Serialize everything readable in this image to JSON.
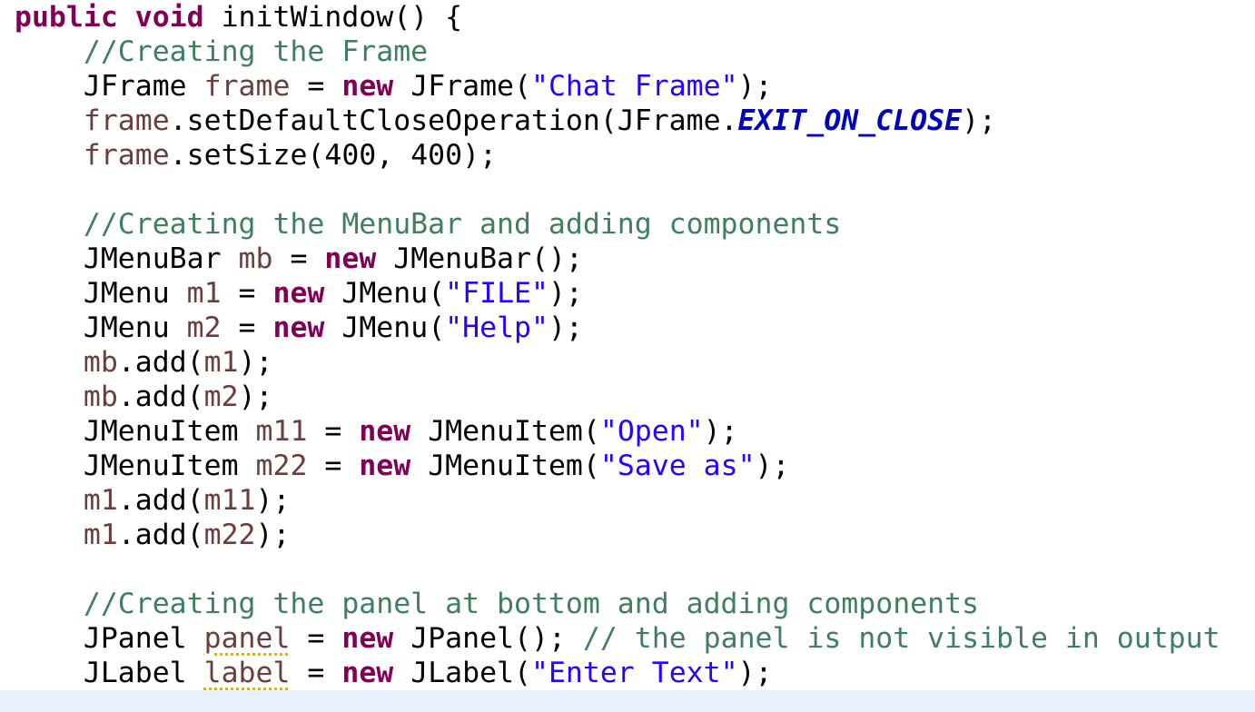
{
  "editor": {
    "lines": [
      {
        "id": "l1",
        "tokens": [
          {
            "t": "kw",
            "v": "public"
          },
          {
            "t": "p",
            "v": " "
          },
          {
            "t": "kw",
            "v": "void"
          },
          {
            "t": "p",
            "v": " initWindow() {"
          }
        ]
      },
      {
        "id": "l2",
        "tokens": [
          {
            "t": "p",
            "v": "    "
          },
          {
            "t": "cm",
            "v": "//Creating the Frame"
          }
        ]
      },
      {
        "id": "l3",
        "tokens": [
          {
            "t": "p",
            "v": "    JFrame "
          },
          {
            "t": "var",
            "v": "frame"
          },
          {
            "t": "p",
            "v": " = "
          },
          {
            "t": "kw",
            "v": "new"
          },
          {
            "t": "p",
            "v": " JFrame("
          },
          {
            "t": "st",
            "v": "\"Chat Frame\""
          },
          {
            "t": "p",
            "v": ");"
          }
        ]
      },
      {
        "id": "l4",
        "tokens": [
          {
            "t": "p",
            "v": "    "
          },
          {
            "t": "var",
            "v": "frame"
          },
          {
            "t": "p",
            "v": ".setDefaultCloseOperation(JFrame."
          },
          {
            "t": "const",
            "v": "EXIT_ON_CLOSE"
          },
          {
            "t": "p",
            "v": ");"
          }
        ]
      },
      {
        "id": "l5",
        "tokens": [
          {
            "t": "p",
            "v": "    "
          },
          {
            "t": "var",
            "v": "frame"
          },
          {
            "t": "p",
            "v": ".setSize(400, 400);"
          }
        ]
      },
      {
        "id": "l6",
        "tokens": []
      },
      {
        "id": "l7",
        "tokens": [
          {
            "t": "p",
            "v": "    "
          },
          {
            "t": "cm",
            "v": "//Creating the MenuBar and adding components"
          }
        ]
      },
      {
        "id": "l8",
        "tokens": [
          {
            "t": "p",
            "v": "    JMenuBar "
          },
          {
            "t": "var",
            "v": "mb"
          },
          {
            "t": "p",
            "v": " = "
          },
          {
            "t": "kw",
            "v": "new"
          },
          {
            "t": "p",
            "v": " JMenuBar();"
          }
        ]
      },
      {
        "id": "l9",
        "tokens": [
          {
            "t": "p",
            "v": "    JMenu "
          },
          {
            "t": "var",
            "v": "m1"
          },
          {
            "t": "p",
            "v": " = "
          },
          {
            "t": "kw",
            "v": "new"
          },
          {
            "t": "p",
            "v": " JMenu("
          },
          {
            "t": "st",
            "v": "\"FILE\""
          },
          {
            "t": "p",
            "v": ");"
          }
        ]
      },
      {
        "id": "l10",
        "tokens": [
          {
            "t": "p",
            "v": "    JMenu "
          },
          {
            "t": "var",
            "v": "m2"
          },
          {
            "t": "p",
            "v": " = "
          },
          {
            "t": "kw",
            "v": "new"
          },
          {
            "t": "p",
            "v": " JMenu("
          },
          {
            "t": "st",
            "v": "\"Help\""
          },
          {
            "t": "p",
            "v": ");"
          }
        ]
      },
      {
        "id": "l11",
        "tokens": [
          {
            "t": "p",
            "v": "    "
          },
          {
            "t": "var",
            "v": "mb"
          },
          {
            "t": "p",
            "v": ".add("
          },
          {
            "t": "var",
            "v": "m1"
          },
          {
            "t": "p",
            "v": ");"
          }
        ]
      },
      {
        "id": "l12",
        "tokens": [
          {
            "t": "p",
            "v": "    "
          },
          {
            "t": "var",
            "v": "mb"
          },
          {
            "t": "p",
            "v": ".add("
          },
          {
            "t": "var",
            "v": "m2"
          },
          {
            "t": "p",
            "v": ");"
          }
        ]
      },
      {
        "id": "l13",
        "tokens": [
          {
            "t": "p",
            "v": "    JMenuItem "
          },
          {
            "t": "var",
            "v": "m11"
          },
          {
            "t": "p",
            "v": " = "
          },
          {
            "t": "kw",
            "v": "new"
          },
          {
            "t": "p",
            "v": " JMenuItem("
          },
          {
            "t": "st",
            "v": "\"Open\""
          },
          {
            "t": "p",
            "v": ");"
          }
        ]
      },
      {
        "id": "l14",
        "tokens": [
          {
            "t": "p",
            "v": "    JMenuItem "
          },
          {
            "t": "var",
            "v": "m22"
          },
          {
            "t": "p",
            "v": " = "
          },
          {
            "t": "kw",
            "v": "new"
          },
          {
            "t": "p",
            "v": " JMenuItem("
          },
          {
            "t": "st",
            "v": "\"Save as\""
          },
          {
            "t": "p",
            "v": ");"
          }
        ]
      },
      {
        "id": "l15",
        "tokens": [
          {
            "t": "p",
            "v": "    "
          },
          {
            "t": "var",
            "v": "m1"
          },
          {
            "t": "p",
            "v": ".add("
          },
          {
            "t": "var",
            "v": "m11"
          },
          {
            "t": "p",
            "v": ");"
          }
        ]
      },
      {
        "id": "l16",
        "tokens": [
          {
            "t": "p",
            "v": "    "
          },
          {
            "t": "var",
            "v": "m1"
          },
          {
            "t": "p",
            "v": ".add("
          },
          {
            "t": "var",
            "v": "m22"
          },
          {
            "t": "p",
            "v": ");"
          }
        ]
      },
      {
        "id": "l17",
        "tokens": []
      },
      {
        "id": "l18",
        "tokens": [
          {
            "t": "p",
            "v": "    "
          },
          {
            "t": "cm",
            "v": "//Creating the panel at bottom and adding components"
          }
        ]
      },
      {
        "id": "l19",
        "tokens": [
          {
            "t": "p",
            "v": "    JPanel "
          },
          {
            "t": "var warn",
            "v": "panel"
          },
          {
            "t": "p",
            "v": " = "
          },
          {
            "t": "kw",
            "v": "new"
          },
          {
            "t": "p",
            "v": " JPanel(); "
          },
          {
            "t": "cm",
            "v": "// the panel is not visible in output"
          }
        ]
      },
      {
        "id": "l20",
        "tokens": [
          {
            "t": "p",
            "v": "    JLabel "
          },
          {
            "t": "var warn",
            "v": "label"
          },
          {
            "t": "p",
            "v": " = "
          },
          {
            "t": "kw",
            "v": "new"
          },
          {
            "t": "p",
            "v": " JLabel("
          },
          {
            "t": "st",
            "v": "\"Enter Text\""
          },
          {
            "t": "p",
            "v": ");"
          }
        ]
      }
    ]
  },
  "colors": {
    "keyword": "#7f0055",
    "comment": "#3f7f5f",
    "string": "#2a00ff",
    "local_variable": "#6a3e3e",
    "static_constant": "#0000c0",
    "warning_underline": "#e0b400",
    "current_line_highlight": "#e8f2fe",
    "background": "#ffffff"
  }
}
